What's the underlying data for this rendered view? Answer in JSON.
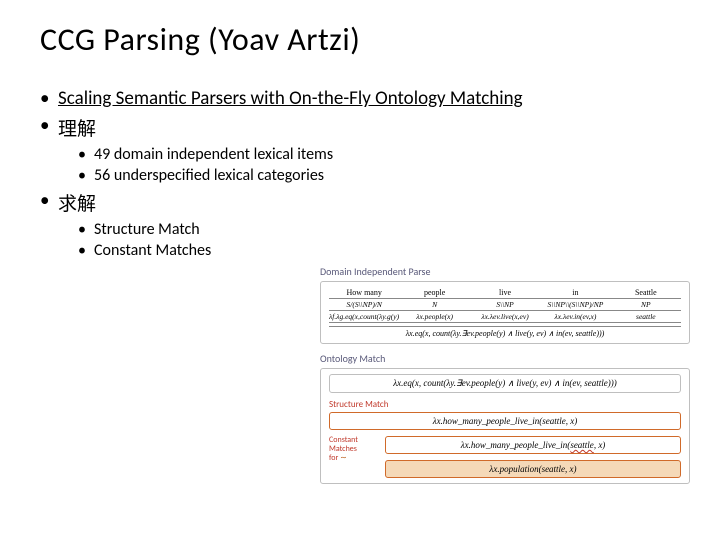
{
  "title": "CCG Parsing (Yoav Artzi)",
  "bullets": {
    "b1": "Scaling Semantic Parsers with On-the-Fly Ontology Matching",
    "b2": "理解",
    "b2_sub1": "49 domain independent lexical items",
    "b2_sub2": "56 underspecified lexical categories",
    "b3": "求解",
    "b3_sub1": "Structure Match",
    "b3_sub2": "Constant Matches"
  },
  "fig": {
    "panel1_label": "Domain Independent Parse",
    "tokens": {
      "t1": "How many",
      "t2": "people",
      "t3": "live",
      "t4": "in",
      "t5": "Seattle"
    },
    "cats": {
      "c1": "S/(S\\\\NP)/N",
      "c2": "N",
      "c3": "S\\\\NP",
      "c4": "S\\\\NP\\\\(S\\\\NP)/NP",
      "c5": "NP"
    },
    "lambdas": {
      "l1": "λf.λg.eq(x,count(λy.g(y)∧f(y)))",
      "l2": "λx.people(x)",
      "l3": "λx.λev.live(x,ev)",
      "l4": "λx.λev.in(ev,x)",
      "l5": "seattle"
    },
    "parse_result": "λx.eq(x, count(λy.∃ev.people(y) ∧ live(y, ev) ∧ in(ev, seattle)))",
    "panel2_label": "Ontology Match",
    "eq_full": "λx.eq(x, count(λy.∃ev.people(y) ∧ live(y, ev) ∧ in(ev, seattle)))",
    "struct_label": "Structure Match",
    "struct_formula": "λx.how_many_people_live_in(seattle, x)",
    "const_label_l1": "Constant",
    "const_label_l2": "Matches",
    "const_label_l3": "for",
    "const_sym": "∼",
    "const_formula_src": "λx.how_many_people_live_in(seattle, x)",
    "wavy_word": "seattle",
    "const_formula_tgt": "λx.population(seattle, x)"
  }
}
